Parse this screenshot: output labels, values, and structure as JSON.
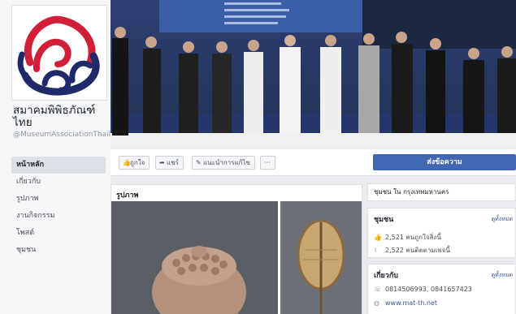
{
  "page": {
    "name": "สมาคมพิพิธภัณฑ์ไทย",
    "handle": "@MuseumAssociationThailand"
  },
  "nav": {
    "items": [
      {
        "label": "หน้าหลัก",
        "active": true
      },
      {
        "label": "เกี่ยวกับ"
      },
      {
        "label": "รูปภาพ"
      },
      {
        "label": "งานกิจกรรม"
      },
      {
        "label": "โพสต์"
      },
      {
        "label": "ชุมชน"
      }
    ]
  },
  "actions": {
    "like": "ถูกใจ",
    "share": "แชร์",
    "suggest": "แนะนำการแก้ไข",
    "more": "···",
    "send_message": "ส่งข้อความ"
  },
  "photos": {
    "title": "รูปภาพ"
  },
  "sidebar": {
    "community_location": "ชุมชน ใน กรุงเทพมหานคร",
    "community": {
      "title": "ชุมชน",
      "see_all": "ดูทั้งหมด",
      "likes": "2,521 คนถูกใจสิ่งนี้",
      "follows": "2,522 คนติดตามเพจนี้"
    },
    "about": {
      "title": "เกี่ยวกับ",
      "see_all": "ดูทั้งหมด",
      "phone": "0814506993, 0841657423",
      "website": "www.mat-th.net"
    }
  },
  "colors": {
    "brand_blue": "#4267b2",
    "link": "#365899",
    "logo_red": "#d11f3a",
    "logo_navy": "#1f2a6b"
  }
}
